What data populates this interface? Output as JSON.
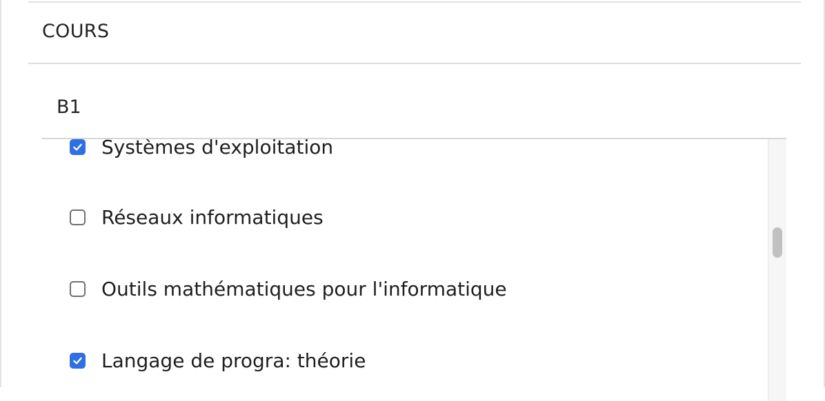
{
  "section": {
    "title": "COURS"
  },
  "group": {
    "title": "B1"
  },
  "courses": [
    {
      "label": "Systèmes d'exploitation",
      "checked": true
    },
    {
      "label": "Réseaux informatiques",
      "checked": false
    },
    {
      "label": "Outils mathématiques pour l'informatique",
      "checked": false
    },
    {
      "label": "Langage de progra: théorie",
      "checked": true
    }
  ],
  "colors": {
    "checkbox_checked": "#2f6fe4",
    "checkbox_border": "#6f6f6f",
    "divider": "#dcdcdc"
  },
  "icons": {
    "checked": "check-icon"
  }
}
